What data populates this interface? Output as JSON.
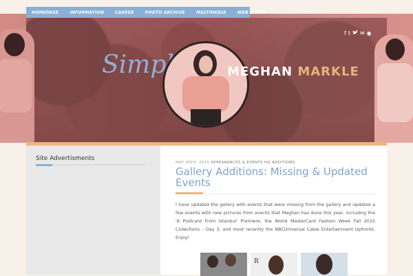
{
  "nav": {
    "items": [
      "HOMEPAGE",
      "INFORMATION",
      "CAREER",
      "PHOTO ARCHIVE",
      "MULTIMEDIA",
      "WEB & SITE"
    ]
  },
  "social": {
    "icons": [
      "facebook-icon",
      "tumblr-icon",
      "twitter-icon",
      "email-icon",
      "rss-icon"
    ],
    "glyphs": [
      "f",
      "t",
      "🐦",
      "✉",
      "◉"
    ]
  },
  "logo": {
    "script": "Simply",
    "first": "MEGHAN",
    "last": "MARKLE"
  },
  "sidebar": {
    "title": "Site Advertisments"
  },
  "post": {
    "date": "MAY 30TH, 2015",
    "categories": "APPEARANCES & EVENTS HQ ADDITIONS",
    "title": "Gallery Additions: Missing & Updated Events",
    "body": "I have updated the gallery with events that were missing from the gallery and updated a few events with new pictures from events that Meghan has done this year, including the 'A Postcard From Istanbul' Premiere, the World MasterCard Fashion Week Fall 2015 Collections – Day 3, and most recently the NBCUniversal Cable Entertainment Upfronts. Enjoy!"
  },
  "thumbs": {
    "t2_label": "R"
  },
  "colors": {
    "nav": "#8ab0d4",
    "accent_orange": "#efb57a",
    "title_blue": "#7fa3cc",
    "sidebar_bg": "#e9e9e9"
  }
}
